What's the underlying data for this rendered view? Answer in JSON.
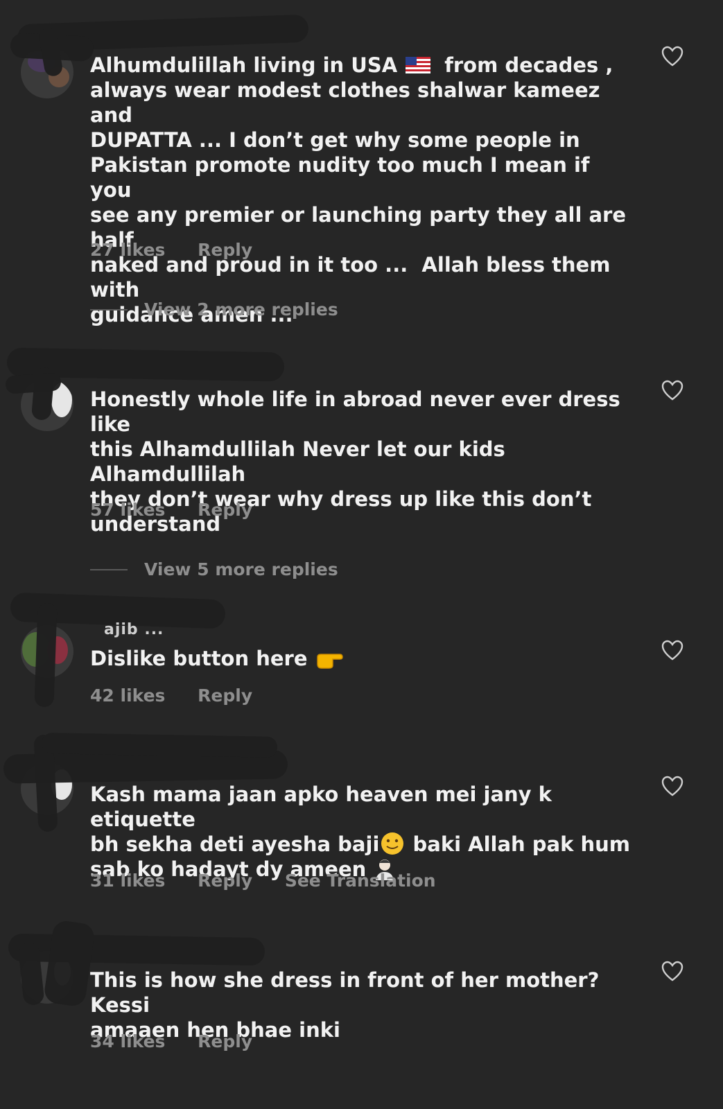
{
  "comments": [
    {
      "username_visible": "",
      "text_before_flag": "Alhumdulillah living in USA",
      "flag_icon": "us-flag-icon",
      "text_after_flag": " from decades ,\nalways wear modest clothes shalwar kameez and\nDUPATTA ... I don’t get why some people in\nPakistan promote nudity too much I mean if you\nsee any premier or launching party they all are half\nnaked and proud in it too ...  Allah bless them with\nguidance amen ...",
      "likes": "27 likes",
      "reply": "Reply",
      "view_replies": "View 2 more replies"
    },
    {
      "username_visible": "",
      "text": "Honestly whole life in abroad never ever dress like\nthis Alhamdullilah Never let our kids Alhamdullilah\nthey don’t wear why dress up like this don’t\nunderstand",
      "likes": "57 likes",
      "reply": "Reply",
      "view_replies": "View 5 more replies"
    },
    {
      "username_visible": "ajib ...",
      "text": "Dislike button here",
      "emoji_icon": "pointing-right-hand-icon",
      "likes": "42 likes",
      "reply": "Reply"
    },
    {
      "username_visible": "",
      "text_part1": "Kash mama jaan apko heaven mei jany k etiquette\nbh sekha deti ayesha baji",
      "emoji1_icon": "slightly-smiling-face-icon",
      "text_part2": " baki Allah pak hum\nsab ko hadayt dy ameen",
      "emoji2_icon": "man-gesturing-no-icon",
      "likes": "31 likes",
      "reply": "Reply",
      "see_translation": "See Translation"
    },
    {
      "username_visible": "",
      "text": "This is how she dress in front of her mother? Kessi\namaaen hen bhae inki",
      "likes": "34 likes",
      "reply": "Reply"
    }
  ],
  "colors": {
    "background": "#262626",
    "primary_text": "#f2f2f2",
    "secondary_text": "#8e8e8e",
    "redaction": "#1f1f1f"
  }
}
